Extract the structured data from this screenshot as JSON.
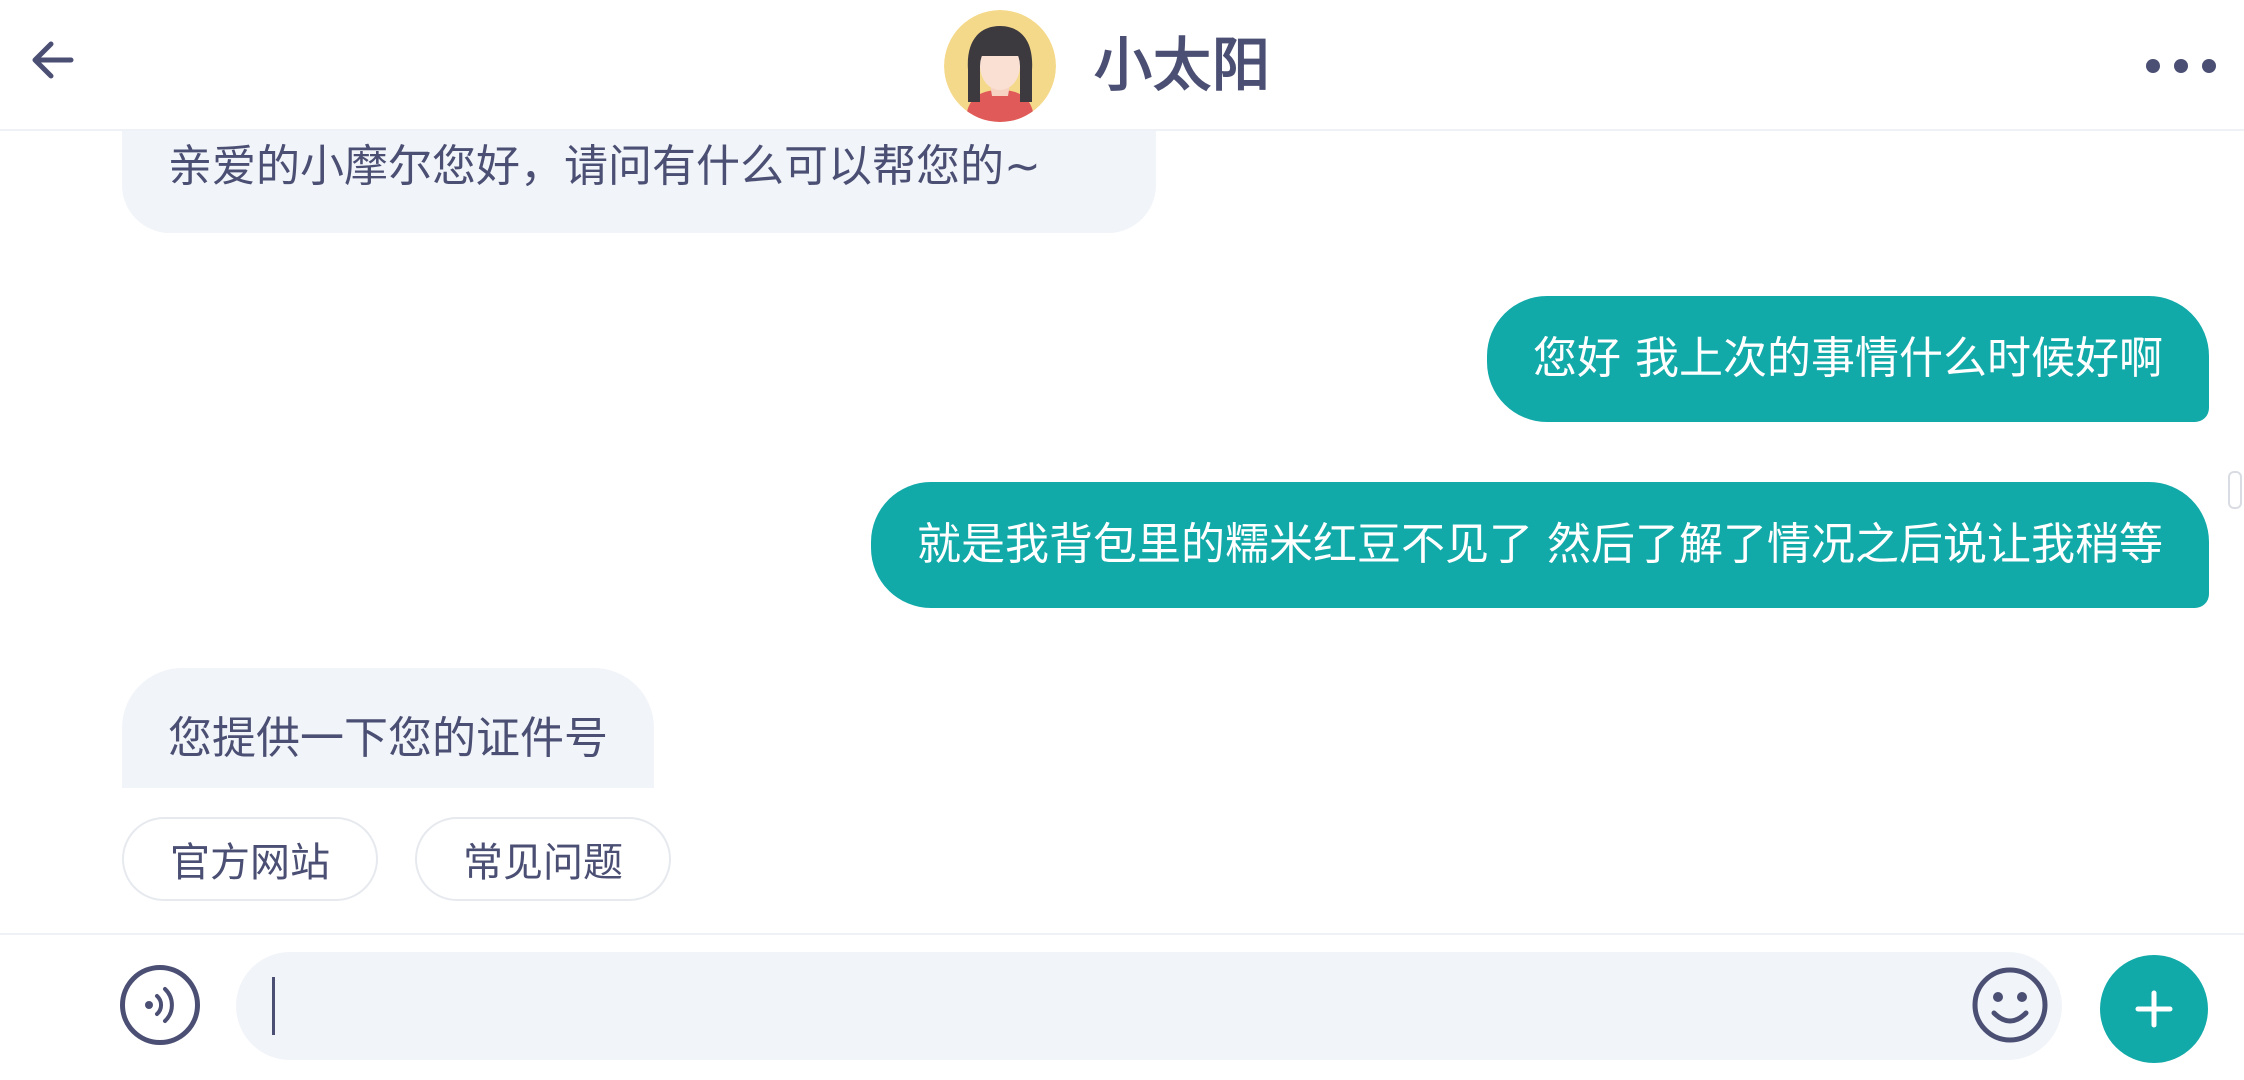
{
  "header": {
    "title": "小太阳",
    "back_icon": "arrow-left-icon",
    "more_icon": "more-horizontal-icon",
    "avatar": "girl-avatar"
  },
  "messages": [
    {
      "side": "incoming",
      "text": "亲爱的小摩尔您好，请问有什么可以帮您的~"
    },
    {
      "side": "outgoing",
      "text": "您好 我上次的事情什么时候好啊"
    },
    {
      "side": "outgoing",
      "text": "就是我背包里的糯米红豆不见了 然后了解了情况之后说让我稍等"
    },
    {
      "side": "incoming",
      "text": "您提供一下您的证件号"
    }
  ],
  "quick_replies": [
    "官方网站",
    "常见问题"
  ],
  "input": {
    "value": "",
    "placeholder": "",
    "voice_icon": "voice-icon",
    "emoji_icon": "emoji-icon",
    "plus_icon": "plus-icon"
  },
  "colors": {
    "accent": "#12aaa9",
    "text": "#4b4f73",
    "incoming_bubble": "#f1f4f8",
    "avatar_bg": "#f5d98a"
  }
}
